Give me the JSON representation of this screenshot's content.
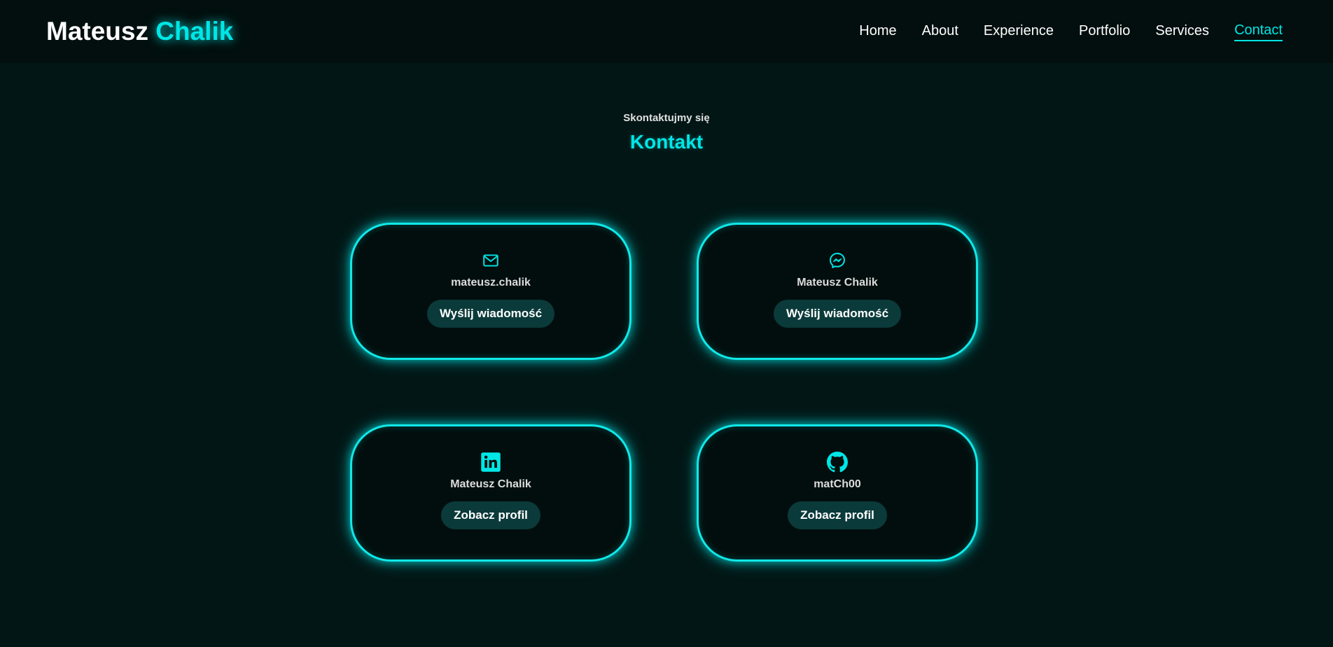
{
  "header": {
    "logo_first": "Mateusz",
    "logo_second": "Chalik",
    "nav": [
      {
        "label": "Home"
      },
      {
        "label": "About"
      },
      {
        "label": "Experience"
      },
      {
        "label": "Portfolio"
      },
      {
        "label": "Services"
      },
      {
        "label": "Contact",
        "active": true
      }
    ]
  },
  "section": {
    "subtitle": "Skontaktujmy się",
    "title": "Kontakt"
  },
  "cards": [
    {
      "icon": "mail-icon",
      "label": "mateusz.chalik",
      "button": "Wyślij wiadomość"
    },
    {
      "icon": "messenger-icon",
      "label": "Mateusz Chalik",
      "button": "Wyślij wiadomość"
    },
    {
      "icon": "linkedin-icon",
      "label": "Mateusz Chalik",
      "button": "Zobacz profil"
    },
    {
      "icon": "github-icon",
      "label": "matCh00",
      "button": "Zobacz profil"
    }
  ],
  "colors": {
    "accent": "#00e6e6",
    "background": "#021615",
    "header_bg": "#020f0e",
    "button_bg": "#0b3a3a"
  }
}
